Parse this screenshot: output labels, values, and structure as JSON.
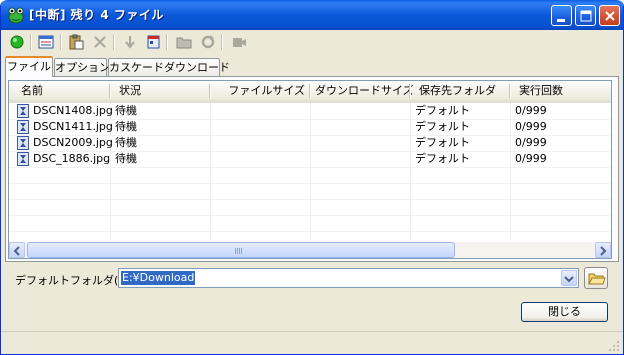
{
  "window": {
    "title": "[中断] 残り 4 ファイル"
  },
  "toolbar": {
    "icons": [
      "start-green-icon",
      "list-view-icon",
      "paste-icon",
      "delete-x-icon",
      "move-down-icon",
      "schedule-icon",
      "folder-icon",
      "refresh-icon",
      "record-icon"
    ]
  },
  "tabs": [
    {
      "label": "ファイル",
      "active": true
    },
    {
      "label": "オプション",
      "active": false
    },
    {
      "label": "カスケードダウンロード",
      "active": false
    }
  ],
  "list": {
    "columns": [
      "名前",
      "状況",
      "ファイルサイズ",
      "ダウンロードサイズ",
      "保存先フォルダ",
      "実行回数"
    ],
    "rows": [
      {
        "name": "DSCN1408.jpg",
        "status": "待機",
        "filesize": "",
        "dlsize": "",
        "folder": "デフォルト",
        "count": "0/999"
      },
      {
        "name": "DSCN1411.jpg",
        "status": "待機",
        "filesize": "",
        "dlsize": "",
        "folder": "デフォルト",
        "count": "0/999"
      },
      {
        "name": "DSCN2009.jpg",
        "status": "待機",
        "filesize": "",
        "dlsize": "",
        "folder": "デフォルト",
        "count": "0/999"
      },
      {
        "name": "DSC_1886.jpg",
        "status": "待機",
        "filesize": "",
        "dlsize": "",
        "folder": "デフォルト",
        "count": "0/999"
      }
    ]
  },
  "default_folder": {
    "label": "デフォルトフォルダ(D):",
    "value": "E:¥Download"
  },
  "buttons": {
    "close": "閉じる"
  },
  "colors": {
    "titlebar": "#0a58d8",
    "selection": "#316ac5",
    "tab_accent": "#e68b2c",
    "face": "#ece9d8"
  }
}
